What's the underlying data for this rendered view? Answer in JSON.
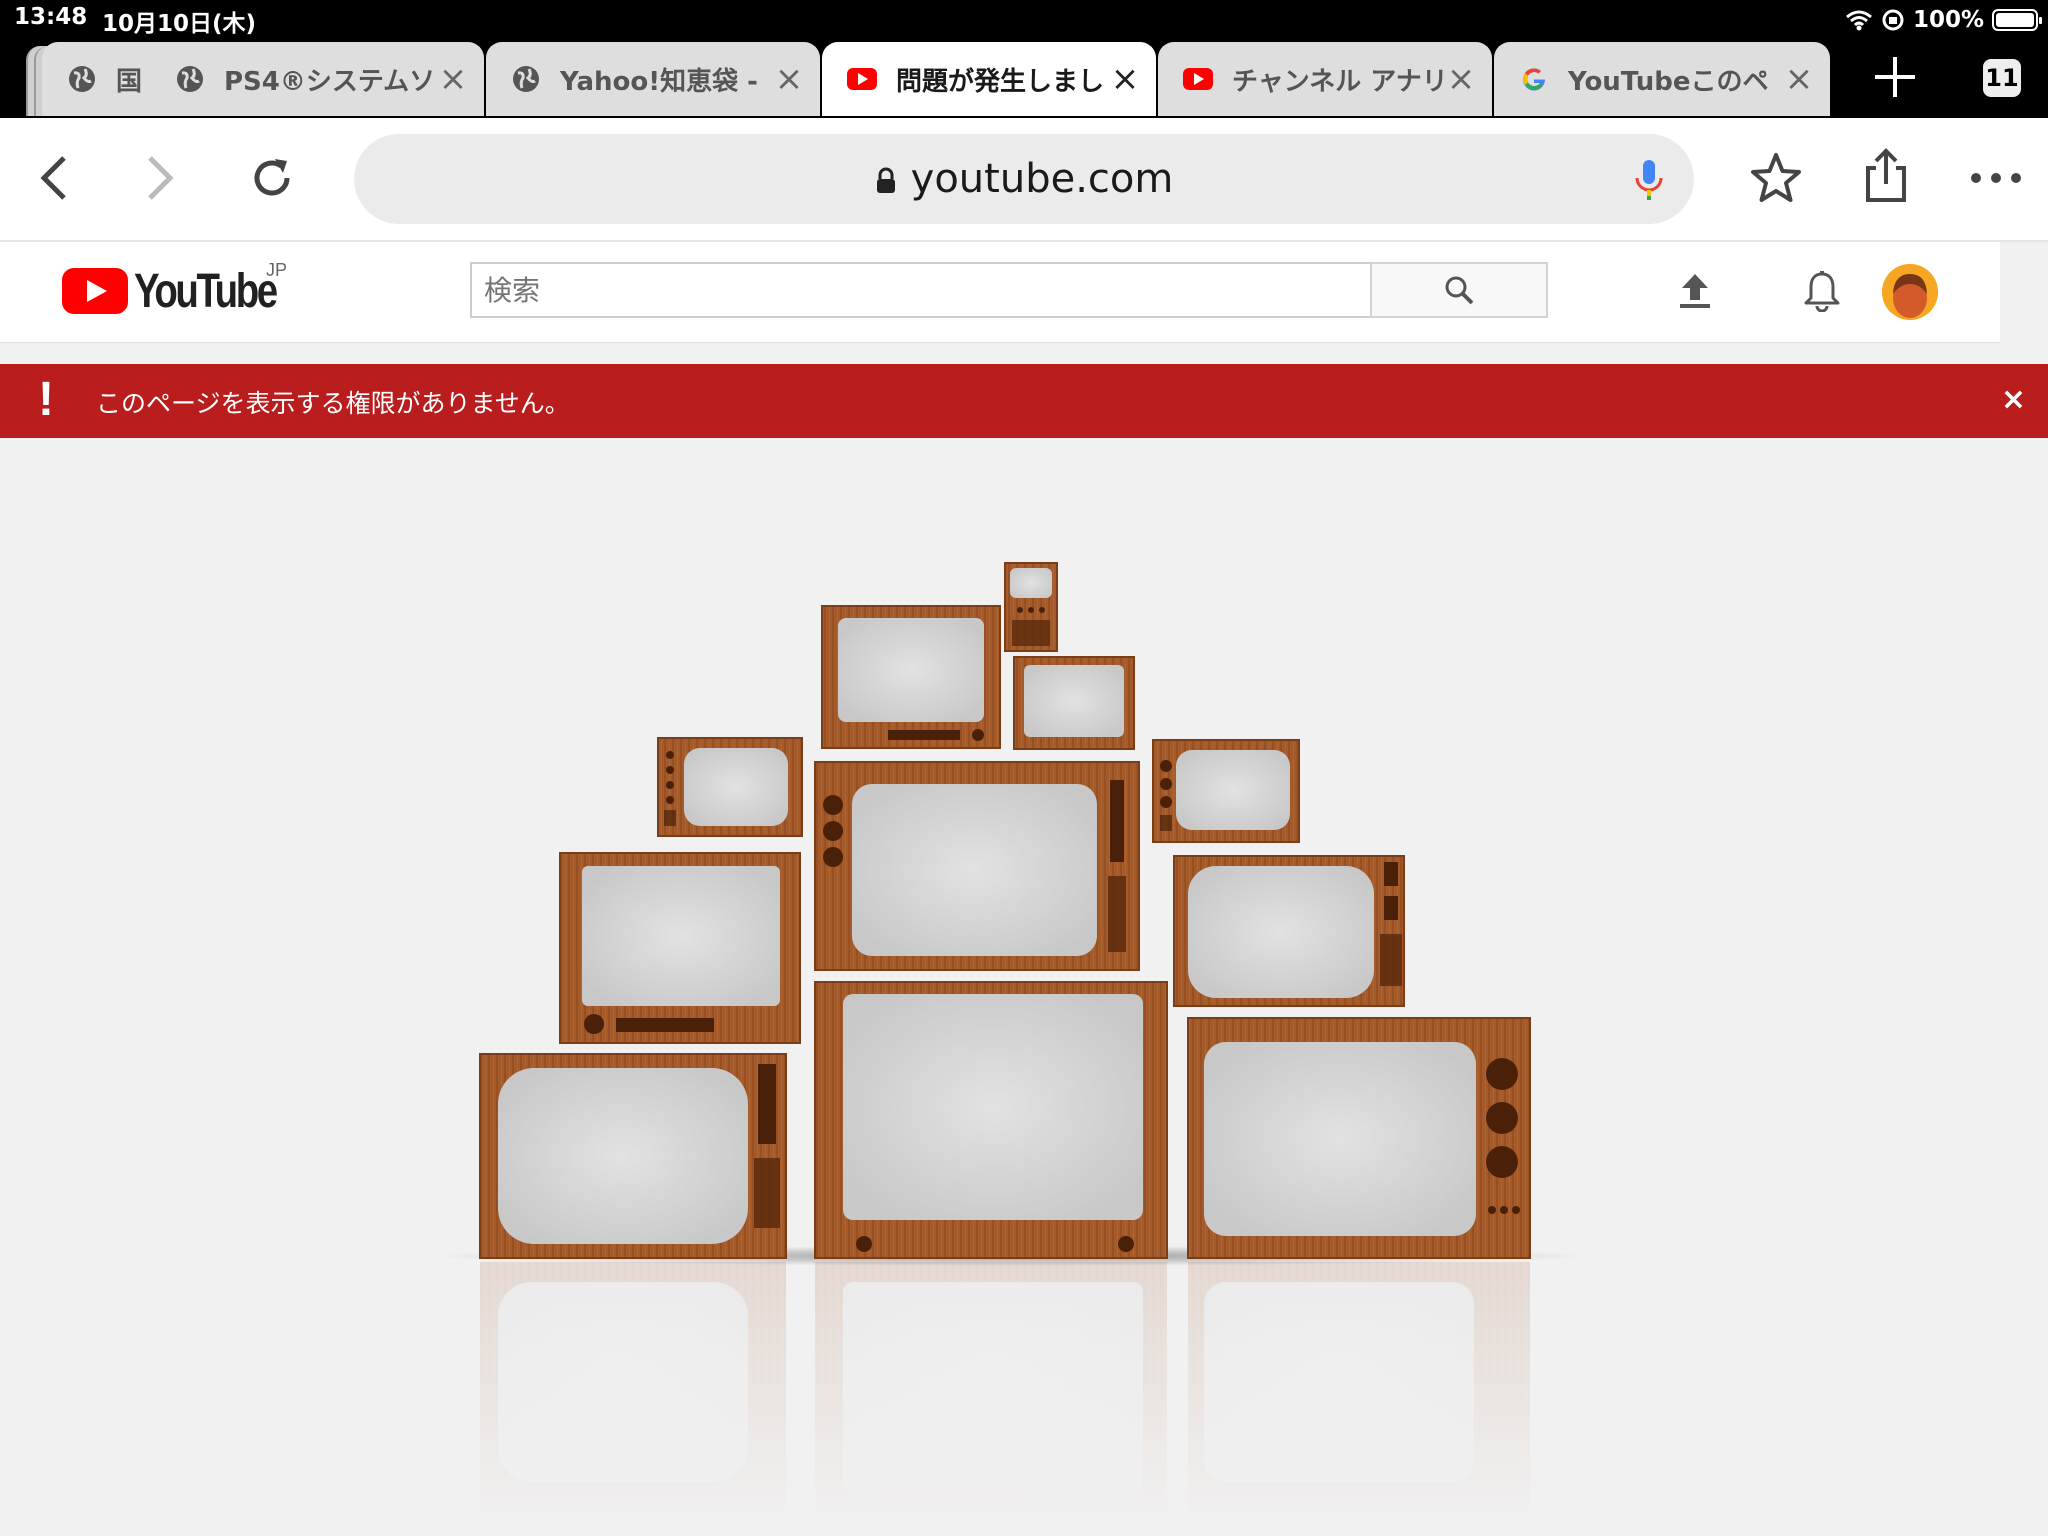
{
  "status_bar": {
    "time": "13:48",
    "date": "10月10日(木)",
    "battery": "100%"
  },
  "tabs": [
    {
      "title": "国",
      "favicon": "globe-icon",
      "active": false
    },
    {
      "title": "PS4®システムソ",
      "favicon": "globe-icon",
      "active": false
    },
    {
      "title": "Yahoo!知恵袋 -",
      "favicon": "globe-icon",
      "active": false
    },
    {
      "title": "問題が発生しまし",
      "favicon": "youtube-icon",
      "active": true
    },
    {
      "title": "チャンネル アナリ",
      "favicon": "youtube-icon",
      "active": false
    },
    {
      "title": "YouTubeこのペ",
      "favicon": "google-icon",
      "active": false
    }
  ],
  "tab_count": "11",
  "toolbar": {
    "url": "youtube.com"
  },
  "youtube": {
    "logo_text": "YouTube",
    "region": "JP",
    "search_placeholder": "検索"
  },
  "error_banner": {
    "icon": "!",
    "message": "このページを表示する権限がありません。",
    "close": "×"
  },
  "colors": {
    "youtube_red": "#ff0000",
    "banner_red": "#b91d1d",
    "wood": "#a0582a",
    "screen": "#d6d6d6"
  }
}
